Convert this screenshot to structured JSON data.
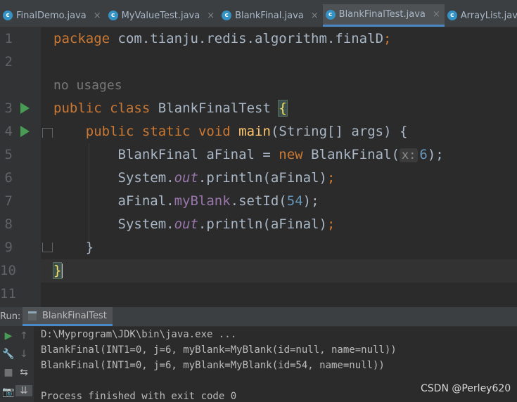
{
  "tabs": [
    {
      "label": "FinalDemo.java",
      "active": false
    },
    {
      "label": "MyValueTest.java",
      "active": false
    },
    {
      "label": "BlankFinal.java",
      "active": false
    },
    {
      "label": "BlankFinalTest.java",
      "active": true
    },
    {
      "label": "ArrayList.java",
      "active": false
    }
  ],
  "tab_close_glyph": "×",
  "file_icon_letter": "c",
  "line_numbers": [
    "1",
    "2",
    "3",
    "4",
    "5",
    "6",
    "7",
    "8",
    "9",
    "10",
    "11"
  ],
  "code": {
    "package_kw": "package",
    "package_name": " com.tianju.redis.algorithm.finalD",
    "semicolon": ";",
    "usage_hint": "no usages",
    "public_kw": "public",
    "class_kw": "class",
    "class_name": "BlankFinalTest",
    "open_brace": "{",
    "static_kw": "static",
    "void_kw": "void",
    "main_name": "main",
    "main_params": "(String[] args) {",
    "line5_a": "BlankFinal aFinal = ",
    "new_kw": "new",
    "line5_b": " BlankFinal(",
    "param_hint": "x:",
    "six": "6",
    "close_paren_semi": ");",
    "system": "System.",
    "out": "out",
    "println_afinal": ".println(aFinal)",
    "afinal_dot": "aFinal.",
    "myblank": "myBlank",
    "setid": ".setId(",
    "fiftyfour": "54",
    "inner_close": "}",
    "outer_close": "}"
  },
  "panel": {
    "run_label": "Run:",
    "tab_label": "BlankFinalTest"
  },
  "console_lines": [
    "D:\\Myprogram\\JDK\\bin\\java.exe ...",
    "BlankFinal(INT1=0, j=6, myBlank=MyBlank(id=null, name=null))",
    "BlankFinal(INT1=0, j=6, myBlank=MyBlank(id=54, name=null))",
    "",
    "Process finished with exit code 0"
  ],
  "toolbar_icons": {
    "rerun": "▶",
    "up": "↑",
    "wrench": "🔧",
    "down": "↓",
    "stop": "■",
    "soft_wrap": "⇆",
    "camera": "📷",
    "scroll_end": "⇊"
  },
  "watermark": "CSDN @Perley620",
  "colors": {
    "editor_bg": "#2b2b2b",
    "keyword": "#cc7832",
    "function": "#ffc66d",
    "field": "#9876aa",
    "number": "#6897bb",
    "text": "#a9b7c6",
    "run_gutter": "#499c54",
    "tab_accent": "#4a88c7"
  }
}
